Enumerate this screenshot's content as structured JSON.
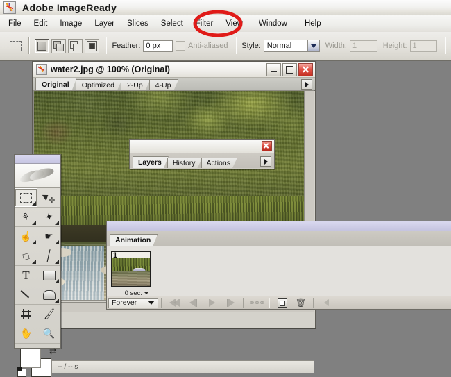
{
  "app": {
    "title": "Adobe ImageReady",
    "logo_icon": "imageready-logo-icon"
  },
  "menubar": {
    "items": [
      {
        "label": "File"
      },
      {
        "label": "Edit"
      },
      {
        "label": "Image"
      },
      {
        "label": "Layer"
      },
      {
        "label": "Slices"
      },
      {
        "label": "Select"
      },
      {
        "label": "Filter"
      },
      {
        "label": "View"
      },
      {
        "label": "Window",
        "highlighted": true
      },
      {
        "label": "Help"
      }
    ],
    "annotation": {
      "shape": "red-ellipse",
      "target": "Window",
      "color": "#e01b18"
    }
  },
  "options_bar": {
    "tool_icon": "rectangular-marquee-icon",
    "selection_modes": [
      {
        "name": "new-selection",
        "active": true
      },
      {
        "name": "add-to-selection",
        "active": false
      },
      {
        "name": "subtract-from-selection",
        "active": false
      },
      {
        "name": "intersect-with-selection",
        "active": false
      }
    ],
    "feather_label": "Feather:",
    "feather_value": "0 px",
    "antialiased_label": "Anti-aliased",
    "antialiased_checked": false,
    "style_label": "Style:",
    "style_value": "Normal",
    "width_label": "Width:",
    "width_value": "1",
    "height_label": "Height:",
    "height_value": "1"
  },
  "document": {
    "title": "water2.jpg @ 100% (Original)",
    "icon": "document-icon",
    "minimize_label": "minimize",
    "maximize_label": "maximize",
    "close_label": "close",
    "tabs": [
      {
        "label": "Original",
        "active": true
      },
      {
        "label": "Optimized",
        "active": false
      },
      {
        "label": "2-Up",
        "active": false
      },
      {
        "label": "4-Up",
        "active": false
      }
    ],
    "tab_overflow_icon": "chevron-right-icon",
    "status": {
      "size_menu_icon": "chevron-down-icon",
      "download_time": "-- / -- s"
    },
    "image": {
      "alt": "forest stream with parked silver sports car"
    }
  },
  "layers_palette": {
    "close_label": "close",
    "tabs": [
      {
        "label": "Layers",
        "active": true
      },
      {
        "label": "History",
        "active": false
      },
      {
        "label": "Actions",
        "active": false
      }
    ],
    "menu_icon": "chevron-right-icon"
  },
  "toolbox": {
    "logo_icon": "feather-logo-icon",
    "tools": [
      {
        "name": "rectangular-marquee-tool",
        "selected": true,
        "has_flyout": true
      },
      {
        "name": "move-tool",
        "selected": false,
        "has_flyout": false
      },
      {
        "name": "slice-tool",
        "selected": false,
        "has_flyout": true
      },
      {
        "name": "slice-select-tool",
        "selected": false,
        "has_flyout": true
      },
      {
        "name": "image-map-tool",
        "selected": false,
        "has_flyout": true
      },
      {
        "name": "image-map-select-tool",
        "selected": false,
        "has_flyout": true
      },
      {
        "name": "eraser-tool",
        "selected": false,
        "has_flyout": true
      },
      {
        "name": "paintbrush-tool",
        "selected": false,
        "has_flyout": true
      },
      {
        "name": "type-tool",
        "selected": false,
        "has_flyout": false
      },
      {
        "name": "rectangle-tool",
        "selected": false,
        "has_flyout": true
      },
      {
        "name": "line-tool",
        "selected": false,
        "has_flyout": false
      },
      {
        "name": "rounded-rectangle-tool",
        "selected": false,
        "has_flyout": true
      },
      {
        "name": "crop-tool",
        "selected": false,
        "has_flyout": false
      },
      {
        "name": "eyedropper-tool",
        "selected": false,
        "has_flyout": false
      },
      {
        "name": "hand-tool",
        "selected": false,
        "has_flyout": false
      },
      {
        "name": "zoom-tool",
        "selected": false,
        "has_flyout": false
      }
    ],
    "colors": {
      "foreground": "#ffffff",
      "background": "#ffffff",
      "swap_icon": "swap-colors-icon",
      "default_icon": "default-colors-icon"
    }
  },
  "animation_palette": {
    "tabs": [
      {
        "label": "Animation",
        "active": true
      }
    ],
    "frames": [
      {
        "number": "1",
        "delay": "0 sec.",
        "selected": true
      }
    ],
    "loop_value": "Forever",
    "controls": [
      {
        "name": "select-first-frame-button",
        "icon": "rewind-icon"
      },
      {
        "name": "select-previous-frame-button",
        "icon": "step-back-icon"
      },
      {
        "name": "play-animation-button",
        "icon": "play-icon"
      },
      {
        "name": "select-next-frame-button",
        "icon": "step-forward-icon"
      },
      {
        "name": "tween-button",
        "icon": "tween-icon"
      },
      {
        "name": "duplicate-frame-button",
        "icon": "duplicate-icon"
      },
      {
        "name": "delete-frame-button",
        "icon": "trash-icon"
      },
      {
        "name": "palette-menu-button",
        "icon": "chevron-left-icon"
      }
    ]
  }
}
